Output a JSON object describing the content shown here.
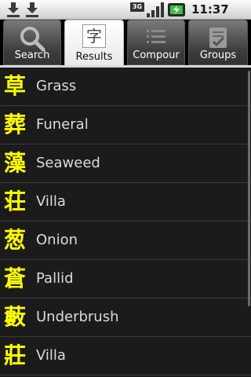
{
  "status": {
    "network": "3G",
    "time": "11:37 AM"
  },
  "tabs": [
    {
      "label": "Search",
      "icon": "magnifier-icon"
    },
    {
      "label": "Results",
      "icon": "kanji-char-icon",
      "glyph": "字",
      "active": true
    },
    {
      "label": "Compour",
      "icon": "list-icon"
    },
    {
      "label": "Groups",
      "icon": "checklist-icon"
    }
  ],
  "results": [
    {
      "kanji": "草",
      "meaning": "Grass"
    },
    {
      "kanji": "葬",
      "meaning": "Funeral"
    },
    {
      "kanji": "藻",
      "meaning": "Seaweed"
    },
    {
      "kanji": "荘",
      "meaning": "Villa"
    },
    {
      "kanji": "葱",
      "meaning": "Onion"
    },
    {
      "kanji": "蒼",
      "meaning": "Pallid"
    },
    {
      "kanji": "藪",
      "meaning": "Underbrush"
    },
    {
      "kanji": "莊",
      "meaning": "Villa"
    }
  ],
  "colors": {
    "kanji": "#ffff00",
    "meaning": "#dcdcdc",
    "background": "#1b1b1b"
  }
}
